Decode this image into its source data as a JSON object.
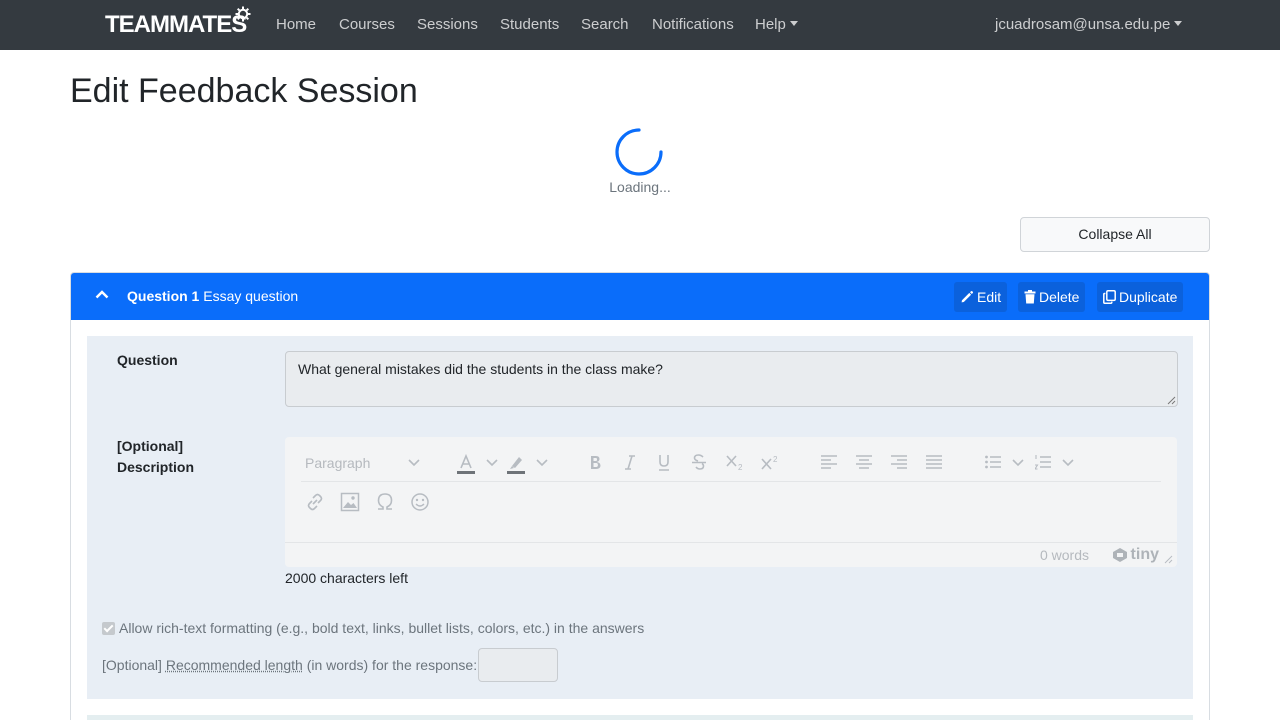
{
  "navbar": {
    "brand": "TEAMMATES",
    "items": [
      "Home",
      "Courses",
      "Sessions",
      "Students",
      "Search",
      "Notifications",
      "Help"
    ],
    "user": "jcuadrosam@unsa.edu.pe"
  },
  "page": {
    "title": "Edit Feedback Session",
    "loading": "Loading...",
    "collapse_all": "Collapse All"
  },
  "question": {
    "number_label": "Question 1",
    "type": "Essay question",
    "edit": "Edit",
    "delete": "Delete",
    "duplicate": "Duplicate",
    "question_label": "Question",
    "question_text": "What general mistakes did the students in the class make?",
    "description_label_1": "[Optional]",
    "description_label_2": "Description",
    "editor": {
      "block_format": "Paragraph",
      "word_count": "0 words",
      "brand": "tiny"
    },
    "chars_left": "2000 characters left",
    "rich_text_label": "Allow rich-text formatting (e.g., bold text, links, bullet lists, colors, etc.) in the answers",
    "rec_prefix": "[Optional]",
    "rec_abbr": "Recommended length",
    "rec_suffix": "(in words) for the response:"
  },
  "colors": {
    "navbar": "#343a40",
    "accent": "#0a6dfa",
    "form_bg": "#e8eef5"
  }
}
